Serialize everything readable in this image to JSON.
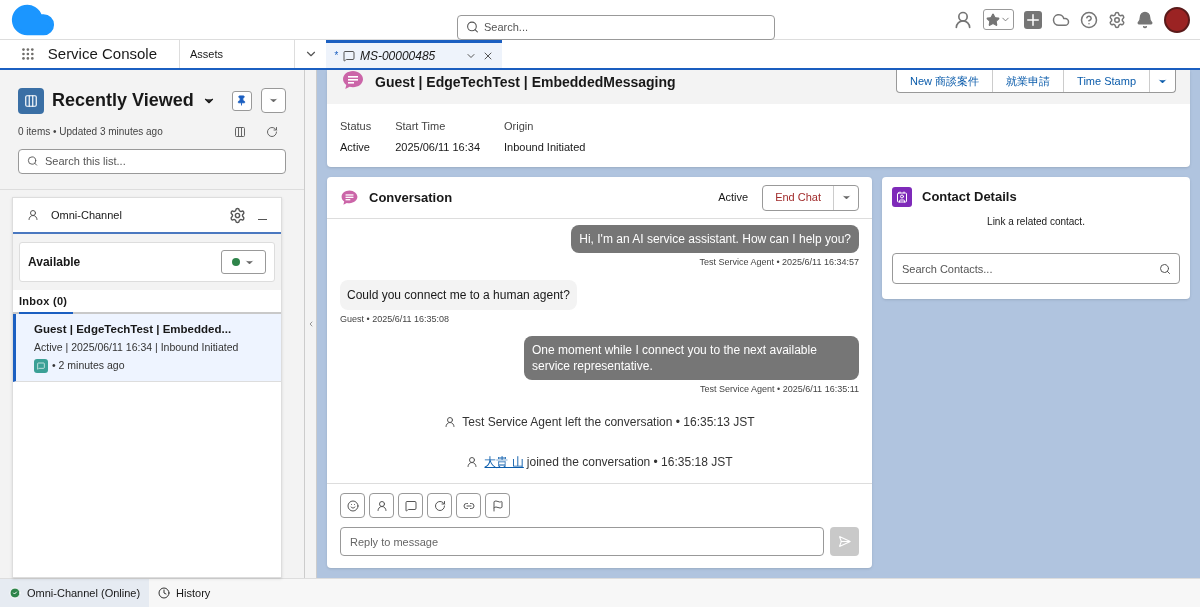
{
  "header": {
    "search_placeholder": "Search..."
  },
  "nav": {
    "app_name": "Service Console",
    "object_tab": "Assets",
    "tabs": [
      {
        "label": "MS-00000485",
        "prefix": "*",
        "selected": true
      }
    ]
  },
  "list_view": {
    "title": "Recently Viewed",
    "meta": "0 items • Updated 3 minutes ago",
    "search_placeholder": "Search this list..."
  },
  "omni": {
    "title": "Omni-Channel",
    "presence": {
      "label": "Available",
      "color": "#2e844a"
    },
    "inbox_label": "Inbox (0)",
    "items": [
      {
        "title": "Guest | EdgeTechTest | Embedded...",
        "details": "Active | 2025/06/11 16:34 | Inbound Initiated",
        "age": "• 2 minutes ago",
        "selected": true
      }
    ]
  },
  "record": {
    "title": "Guest | EdgeTechTest | EmbeddedMessaging",
    "actions": [
      "New 商談案件",
      "就業申請",
      "Time Stamp"
    ],
    "fields": [
      {
        "label": "Status",
        "value": "Active"
      },
      {
        "label": "Start Time",
        "value": "2025/06/11 16:34"
      },
      {
        "label": "Origin",
        "value": "Inbound Initiated"
      }
    ]
  },
  "conversation": {
    "title": "Conversation",
    "status": "Active",
    "end_button": "End Chat",
    "messages": [
      {
        "kind": "outbound",
        "text": "Hi, I'm an AI service assistant. How can I help you?",
        "meta": "Test Service Agent • 2025/6/11 16:34:57"
      },
      {
        "kind": "inbound",
        "text": "Could you connect me to a human agent?",
        "meta": "Guest • 2025/6/11 16:35:08"
      },
      {
        "kind": "outbound",
        "text": "One moment while I connect you to the next available service representative.",
        "meta": "Test Service Agent • 2025/6/11 16:35:11"
      },
      {
        "kind": "event",
        "text": "Test Service Agent left the conversation • 16:35:13 JST"
      },
      {
        "kind": "event",
        "link": "大貴 山",
        "text": "joined the conversation • 16:35:18 JST"
      }
    ],
    "reply_placeholder": "Reply to message"
  },
  "contact": {
    "title": "Contact Details",
    "hint": "Link a related contact.",
    "search_placeholder": "Search Contacts..."
  },
  "utility_bar": [
    {
      "label": "Omni-Channel (Online)",
      "kind": "status",
      "selected": true
    },
    {
      "label": "History",
      "kind": "history",
      "selected": false
    }
  ]
}
